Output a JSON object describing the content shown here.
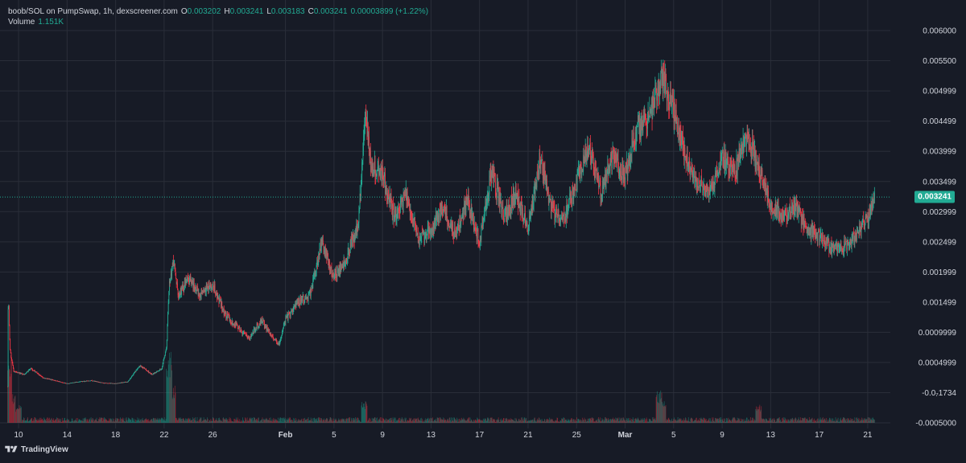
{
  "legend": {
    "symbol": "boob/SOL on PumpSwap, 1h, dexscreener.com",
    "o_label": "O",
    "o_value": "0.003202",
    "h_label": "H",
    "h_value": "0.003241",
    "l_label": "L",
    "l_value": "0.003183",
    "c_label": "C",
    "c_value": "0.003241",
    "change": "0.00003899 (+1.22%)",
    "volume_label": "Volume",
    "volume_value": "1.151K"
  },
  "branding": {
    "name": "TradingView"
  },
  "colors": {
    "background": "#171b26",
    "grid": "#2a2e39",
    "up": "#22ab94",
    "down": "#f23645",
    "text": "#d1d4dc",
    "last_price": "#22ab94"
  },
  "chart_data": {
    "type": "candlestick",
    "timeframe": "1h",
    "last_price": 0.003241,
    "last_price_label": "0.003241",
    "y_ticks": [
      {
        "value": 0.006,
        "label": "0.006000"
      },
      {
        "value": 0.0055,
        "label": "0.005500"
      },
      {
        "value": 0.004999,
        "label": "0.004999"
      },
      {
        "value": 0.004499,
        "label": "0.004499"
      },
      {
        "value": 0.003999,
        "label": "0.003999"
      },
      {
        "value": 0.003499,
        "label": "0.003499"
      },
      {
        "value": 0.002999,
        "label": "0.002999"
      },
      {
        "value": 0.002499,
        "label": "0.002499"
      },
      {
        "value": 0.001999,
        "label": "0.001999"
      },
      {
        "value": 0.001499,
        "label": "0.001499"
      },
      {
        "value": 0.0009999,
        "label": "0.0009999"
      },
      {
        "value": 0.0004999,
        "label": "0.0004999"
      },
      {
        "value": -1.734e-07,
        "label": "-0.0₇1734"
      },
      {
        "value": -0.0005,
        "label": "-0.0005000"
      }
    ],
    "ylim": [
      -0.0005,
      0.0061
    ],
    "x_ticks": [
      {
        "day": 10,
        "label": "10"
      },
      {
        "day": 14,
        "label": "14"
      },
      {
        "day": 18,
        "label": "18"
      },
      {
        "day": 22,
        "label": "22"
      },
      {
        "day": 26,
        "label": "26"
      },
      {
        "day": 32,
        "label": "Feb",
        "bold": true
      },
      {
        "day": 36,
        "label": "5"
      },
      {
        "day": 40,
        "label": "9"
      },
      {
        "day": 44,
        "label": "13"
      },
      {
        "day": 48,
        "label": "17"
      },
      {
        "day": 52,
        "label": "21"
      },
      {
        "day": 56,
        "label": "25"
      },
      {
        "day": 60,
        "label": "Mar",
        "bold": true
      },
      {
        "day": 64,
        "label": "5"
      },
      {
        "day": 68,
        "label": "9"
      },
      {
        "day": 72,
        "label": "13"
      },
      {
        "day": 76,
        "label": "17"
      },
      {
        "day": 80,
        "label": "21"
      }
    ],
    "xlim": [
      9.0,
      81.2
    ],
    "close_path": [
      [
        9.1,
        0.0001
      ],
      [
        9.15,
        0.0016
      ],
      [
        9.3,
        0.0007
      ],
      [
        9.6,
        0.00035
      ],
      [
        10.5,
        0.0003
      ],
      [
        11,
        0.0004
      ],
      [
        12,
        0.00025
      ],
      [
        13,
        0.0002
      ],
      [
        14,
        0.00015
      ],
      [
        15,
        0.00018
      ],
      [
        16,
        0.0002
      ],
      [
        17,
        0.00016
      ],
      [
        18,
        0.00015
      ],
      [
        19,
        0.00018
      ],
      [
        20,
        0.00045
      ],
      [
        21,
        0.0003
      ],
      [
        21.8,
        0.0004
      ],
      [
        22.2,
        0.00075
      ],
      [
        22.4,
        0.0018
      ],
      [
        22.8,
        0.0022
      ],
      [
        23.2,
        0.0016
      ],
      [
        24,
        0.0019
      ],
      [
        25,
        0.0016
      ],
      [
        26,
        0.0018
      ],
      [
        27,
        0.0013
      ],
      [
        28,
        0.0011
      ],
      [
        29,
        0.0009
      ],
      [
        30,
        0.0012
      ],
      [
        31,
        0.0009
      ],
      [
        31.5,
        0.0008
      ],
      [
        32,
        0.0012
      ],
      [
        33,
        0.0015
      ],
      [
        34,
        0.0016
      ],
      [
        35,
        0.0025
      ],
      [
        36,
        0.0019
      ],
      [
        37,
        0.0022
      ],
      [
        38,
        0.0028
      ],
      [
        38.6,
        0.0048
      ],
      [
        39,
        0.0038
      ],
      [
        40,
        0.0036
      ],
      [
        41,
        0.0029
      ],
      [
        42,
        0.0033
      ],
      [
        43,
        0.0025
      ],
      [
        44,
        0.0027
      ],
      [
        45,
        0.0031
      ],
      [
        46,
        0.0026
      ],
      [
        47,
        0.0032
      ],
      [
        48,
        0.0025
      ],
      [
        49,
        0.0037
      ],
      [
        50,
        0.0029
      ],
      [
        51,
        0.0033
      ],
      [
        52,
        0.0027
      ],
      [
        53,
        0.0039
      ],
      [
        54,
        0.003
      ],
      [
        55,
        0.0029
      ],
      [
        56,
        0.0035
      ],
      [
        57,
        0.0041
      ],
      [
        58,
        0.0033
      ],
      [
        59,
        0.0039
      ],
      [
        60,
        0.0036
      ],
      [
        61,
        0.0044
      ],
      [
        62,
        0.0046
      ],
      [
        63,
        0.0052
      ],
      [
        64,
        0.0047
      ],
      [
        65,
        0.0039
      ],
      [
        66,
        0.0035
      ],
      [
        67,
        0.0033
      ],
      [
        68,
        0.0039
      ],
      [
        69,
        0.0036
      ],
      [
        70,
        0.0043
      ],
      [
        71,
        0.0037
      ],
      [
        72,
        0.0031
      ],
      [
        73,
        0.0029
      ],
      [
        74,
        0.0031
      ],
      [
        75,
        0.0027
      ],
      [
        76,
        0.0026
      ],
      [
        77,
        0.0024
      ],
      [
        78,
        0.0024
      ],
      [
        79,
        0.0026
      ],
      [
        80,
        0.0029
      ],
      [
        80.6,
        0.003241
      ]
    ],
    "volume_spikes": [
      [
        9.2,
        1.0
      ],
      [
        9.5,
        0.4
      ],
      [
        10.0,
        0.25
      ],
      [
        22.4,
        1.0
      ],
      [
        22.7,
        0.55
      ],
      [
        38.5,
        0.3
      ],
      [
        62.8,
        0.45
      ],
      [
        63.1,
        0.3
      ],
      [
        71.0,
        0.25
      ]
    ]
  }
}
